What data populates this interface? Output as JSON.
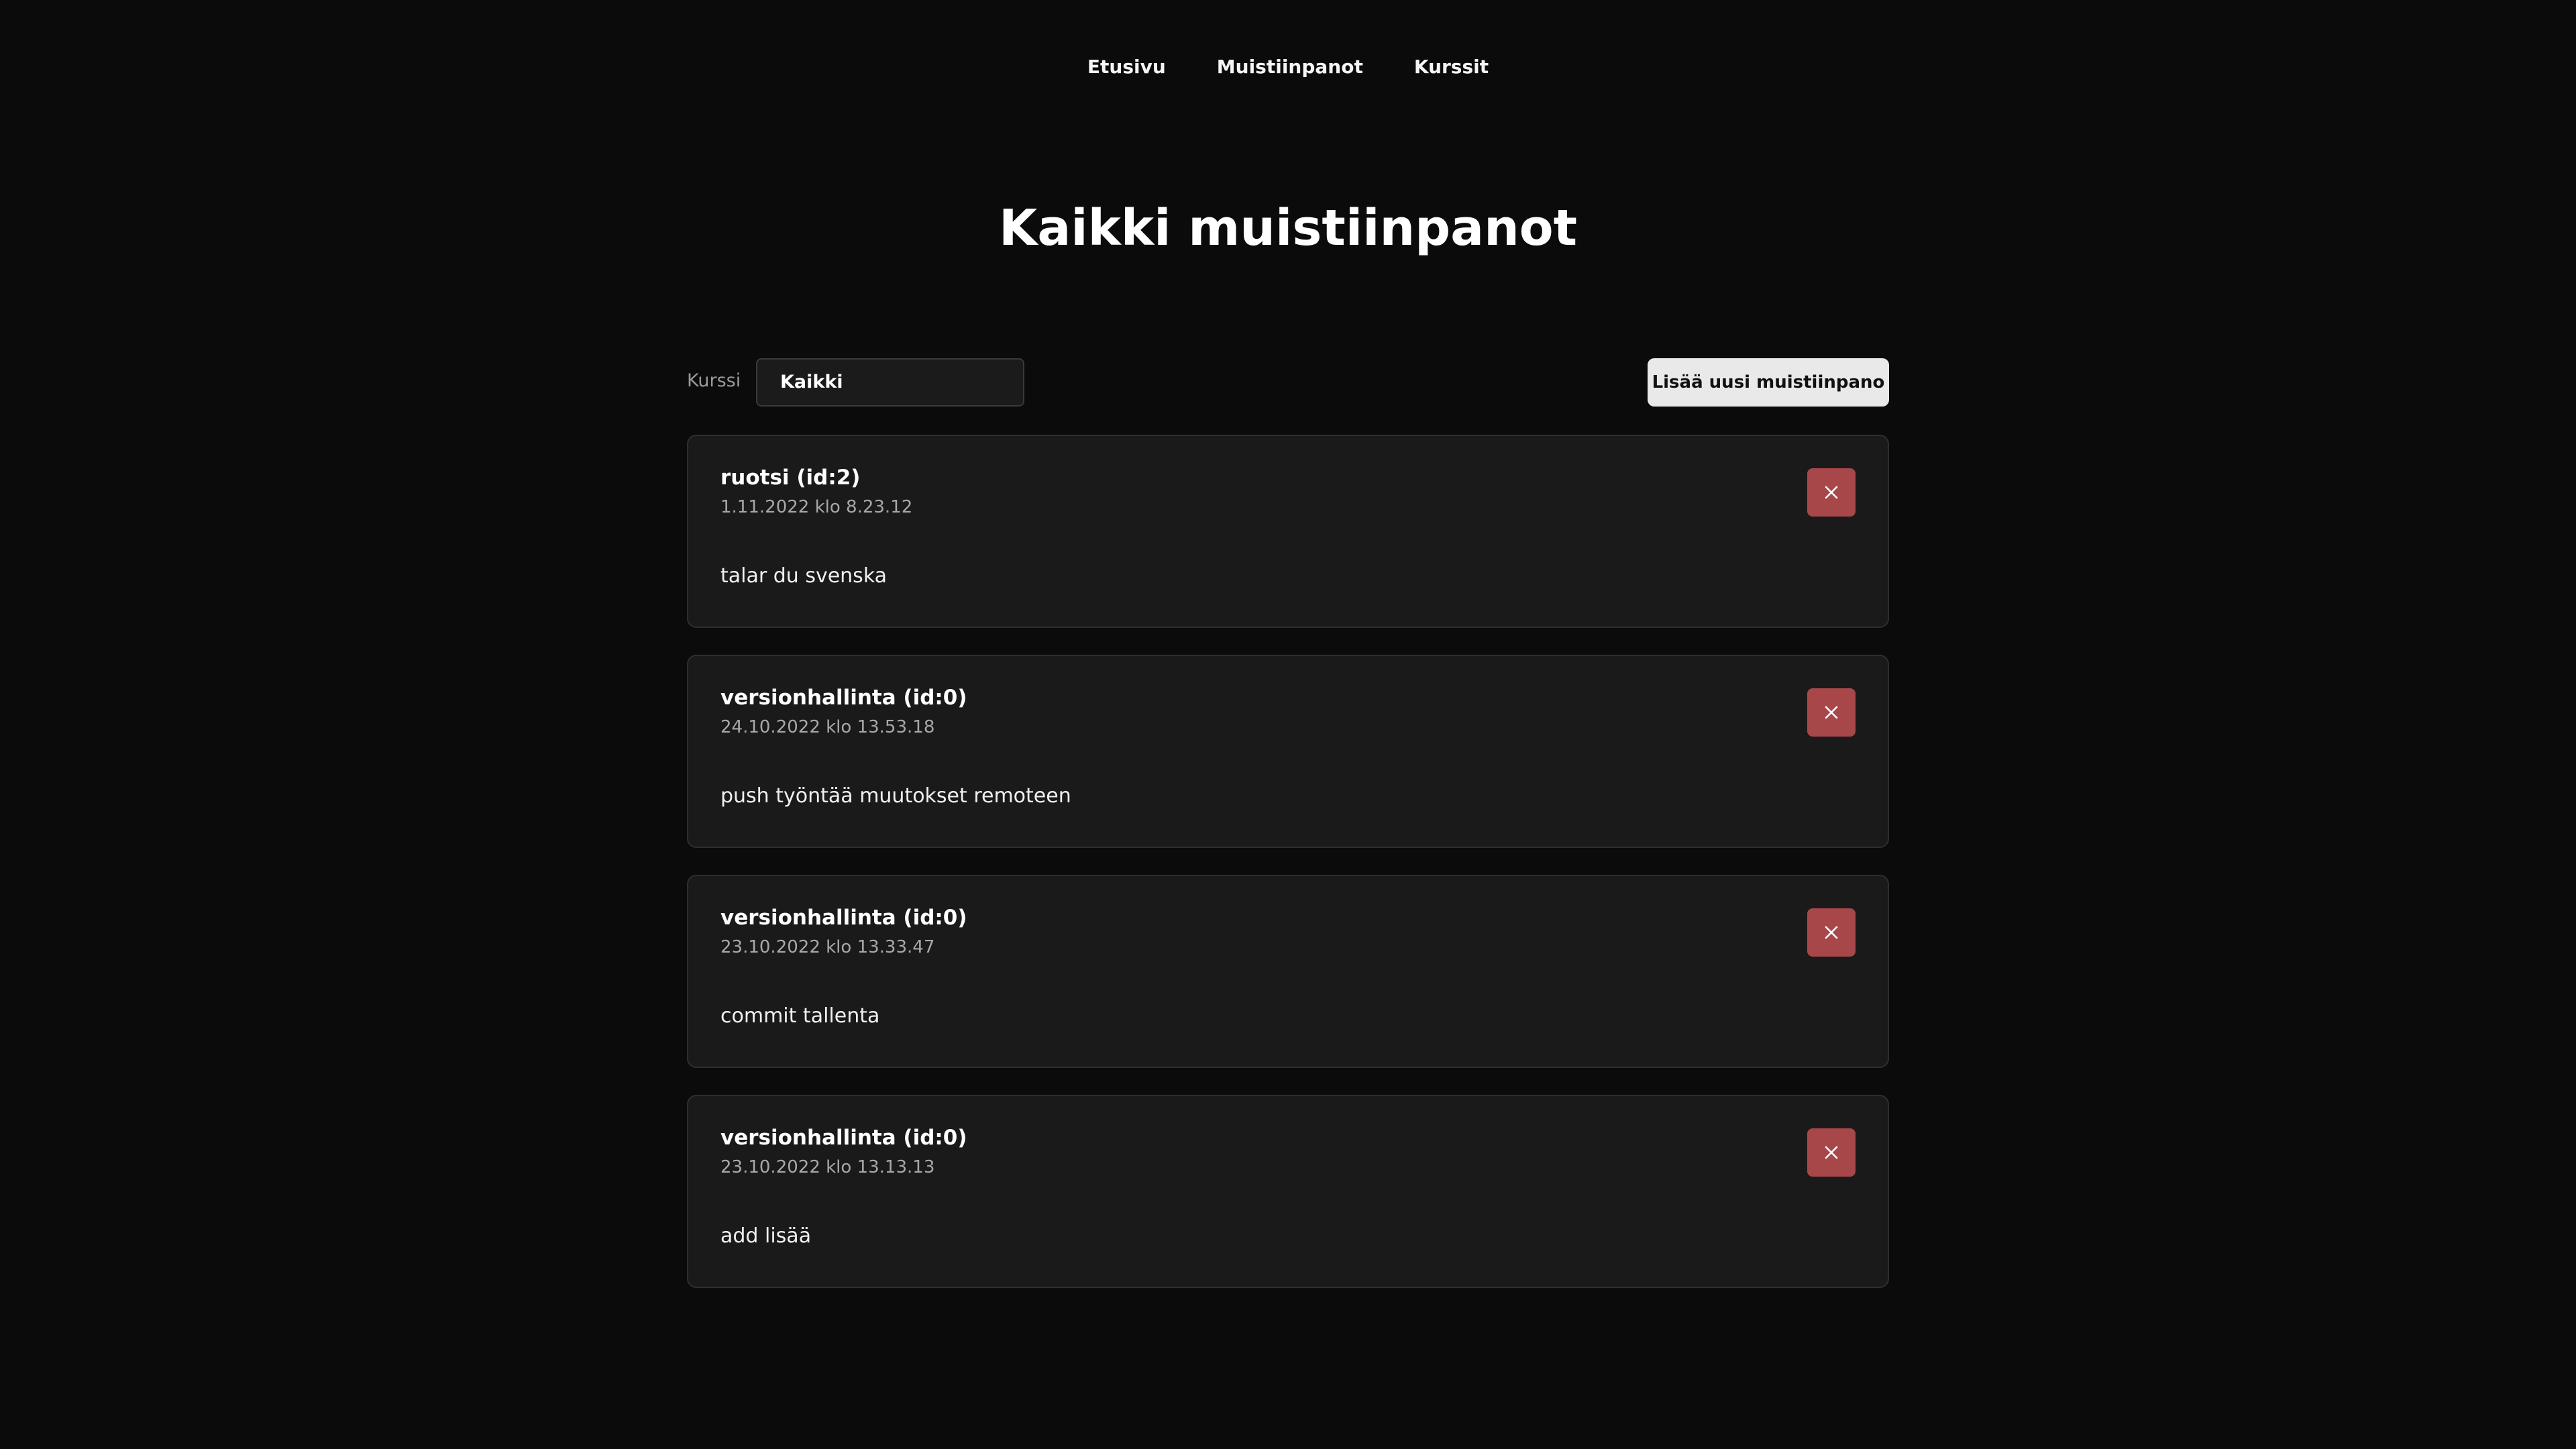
{
  "nav": {
    "items": [
      {
        "label": "Etusivu"
      },
      {
        "label": "Muistiinpanot"
      },
      {
        "label": "Kurssit"
      }
    ]
  },
  "page": {
    "title": "Kaikki muistiinpanot"
  },
  "filter": {
    "label": "Kurssi",
    "selected": "Kaikki"
  },
  "toolbar": {
    "add_label": "Lisää uusi muistiinpano"
  },
  "notes": [
    {
      "course": "ruotsi (id:2)",
      "time": "1.11.2022 klo 8.23.12",
      "text": "talar du svenska",
      "delete_icon": "close-icon"
    },
    {
      "course": "versionhallinta (id:0)",
      "time": "24.10.2022 klo 13.53.18",
      "text": "push työntää muutokset remoteen",
      "delete_icon": "close-icon"
    },
    {
      "course": "versionhallinta (id:0)",
      "time": "23.10.2022 klo 13.33.47",
      "text": "commit tallenta",
      "delete_icon": "close-icon"
    },
    {
      "course": "versionhallinta (id:0)",
      "time": "23.10.2022 klo 13.13.13",
      "text": "add lisää",
      "delete_icon": "close-icon"
    }
  ],
  "colors": {
    "background": "#0b0b0b",
    "card": "#1a1a1a",
    "delete": "#a8474a",
    "add_button": "#e9e9e9"
  }
}
